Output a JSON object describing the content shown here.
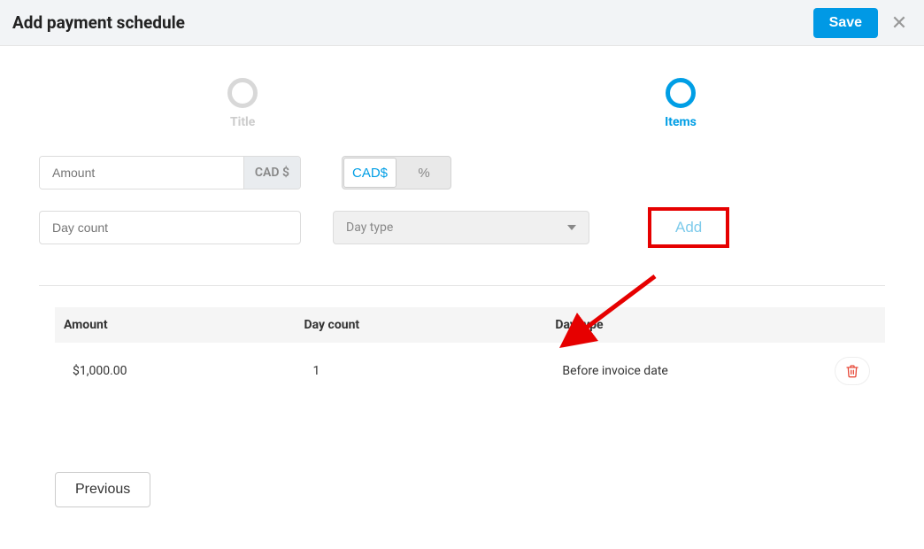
{
  "header": {
    "title": "Add payment schedule",
    "save_label": "Save"
  },
  "steps": {
    "title_label": "Title",
    "items_label": "Items",
    "active": "items"
  },
  "inputs": {
    "amount_placeholder": "Amount",
    "amount_suffix": "CAD $",
    "toggle_currency": "CAD$",
    "toggle_percent": "%",
    "daycount_placeholder": "Day count",
    "daytype_placeholder": "Day type",
    "add_label": "Add"
  },
  "table": {
    "headers": {
      "amount": "Amount",
      "daycount": "Day count",
      "daytype": "Day type"
    },
    "rows": [
      {
        "amount": "$1,000.00",
        "daycount": "1",
        "daytype": "Before invoice date"
      }
    ]
  },
  "footer": {
    "previous_label": "Previous"
  },
  "colors": {
    "accent": "#009ee5",
    "highlight": "#e60000",
    "danger": "#e74c3c"
  }
}
